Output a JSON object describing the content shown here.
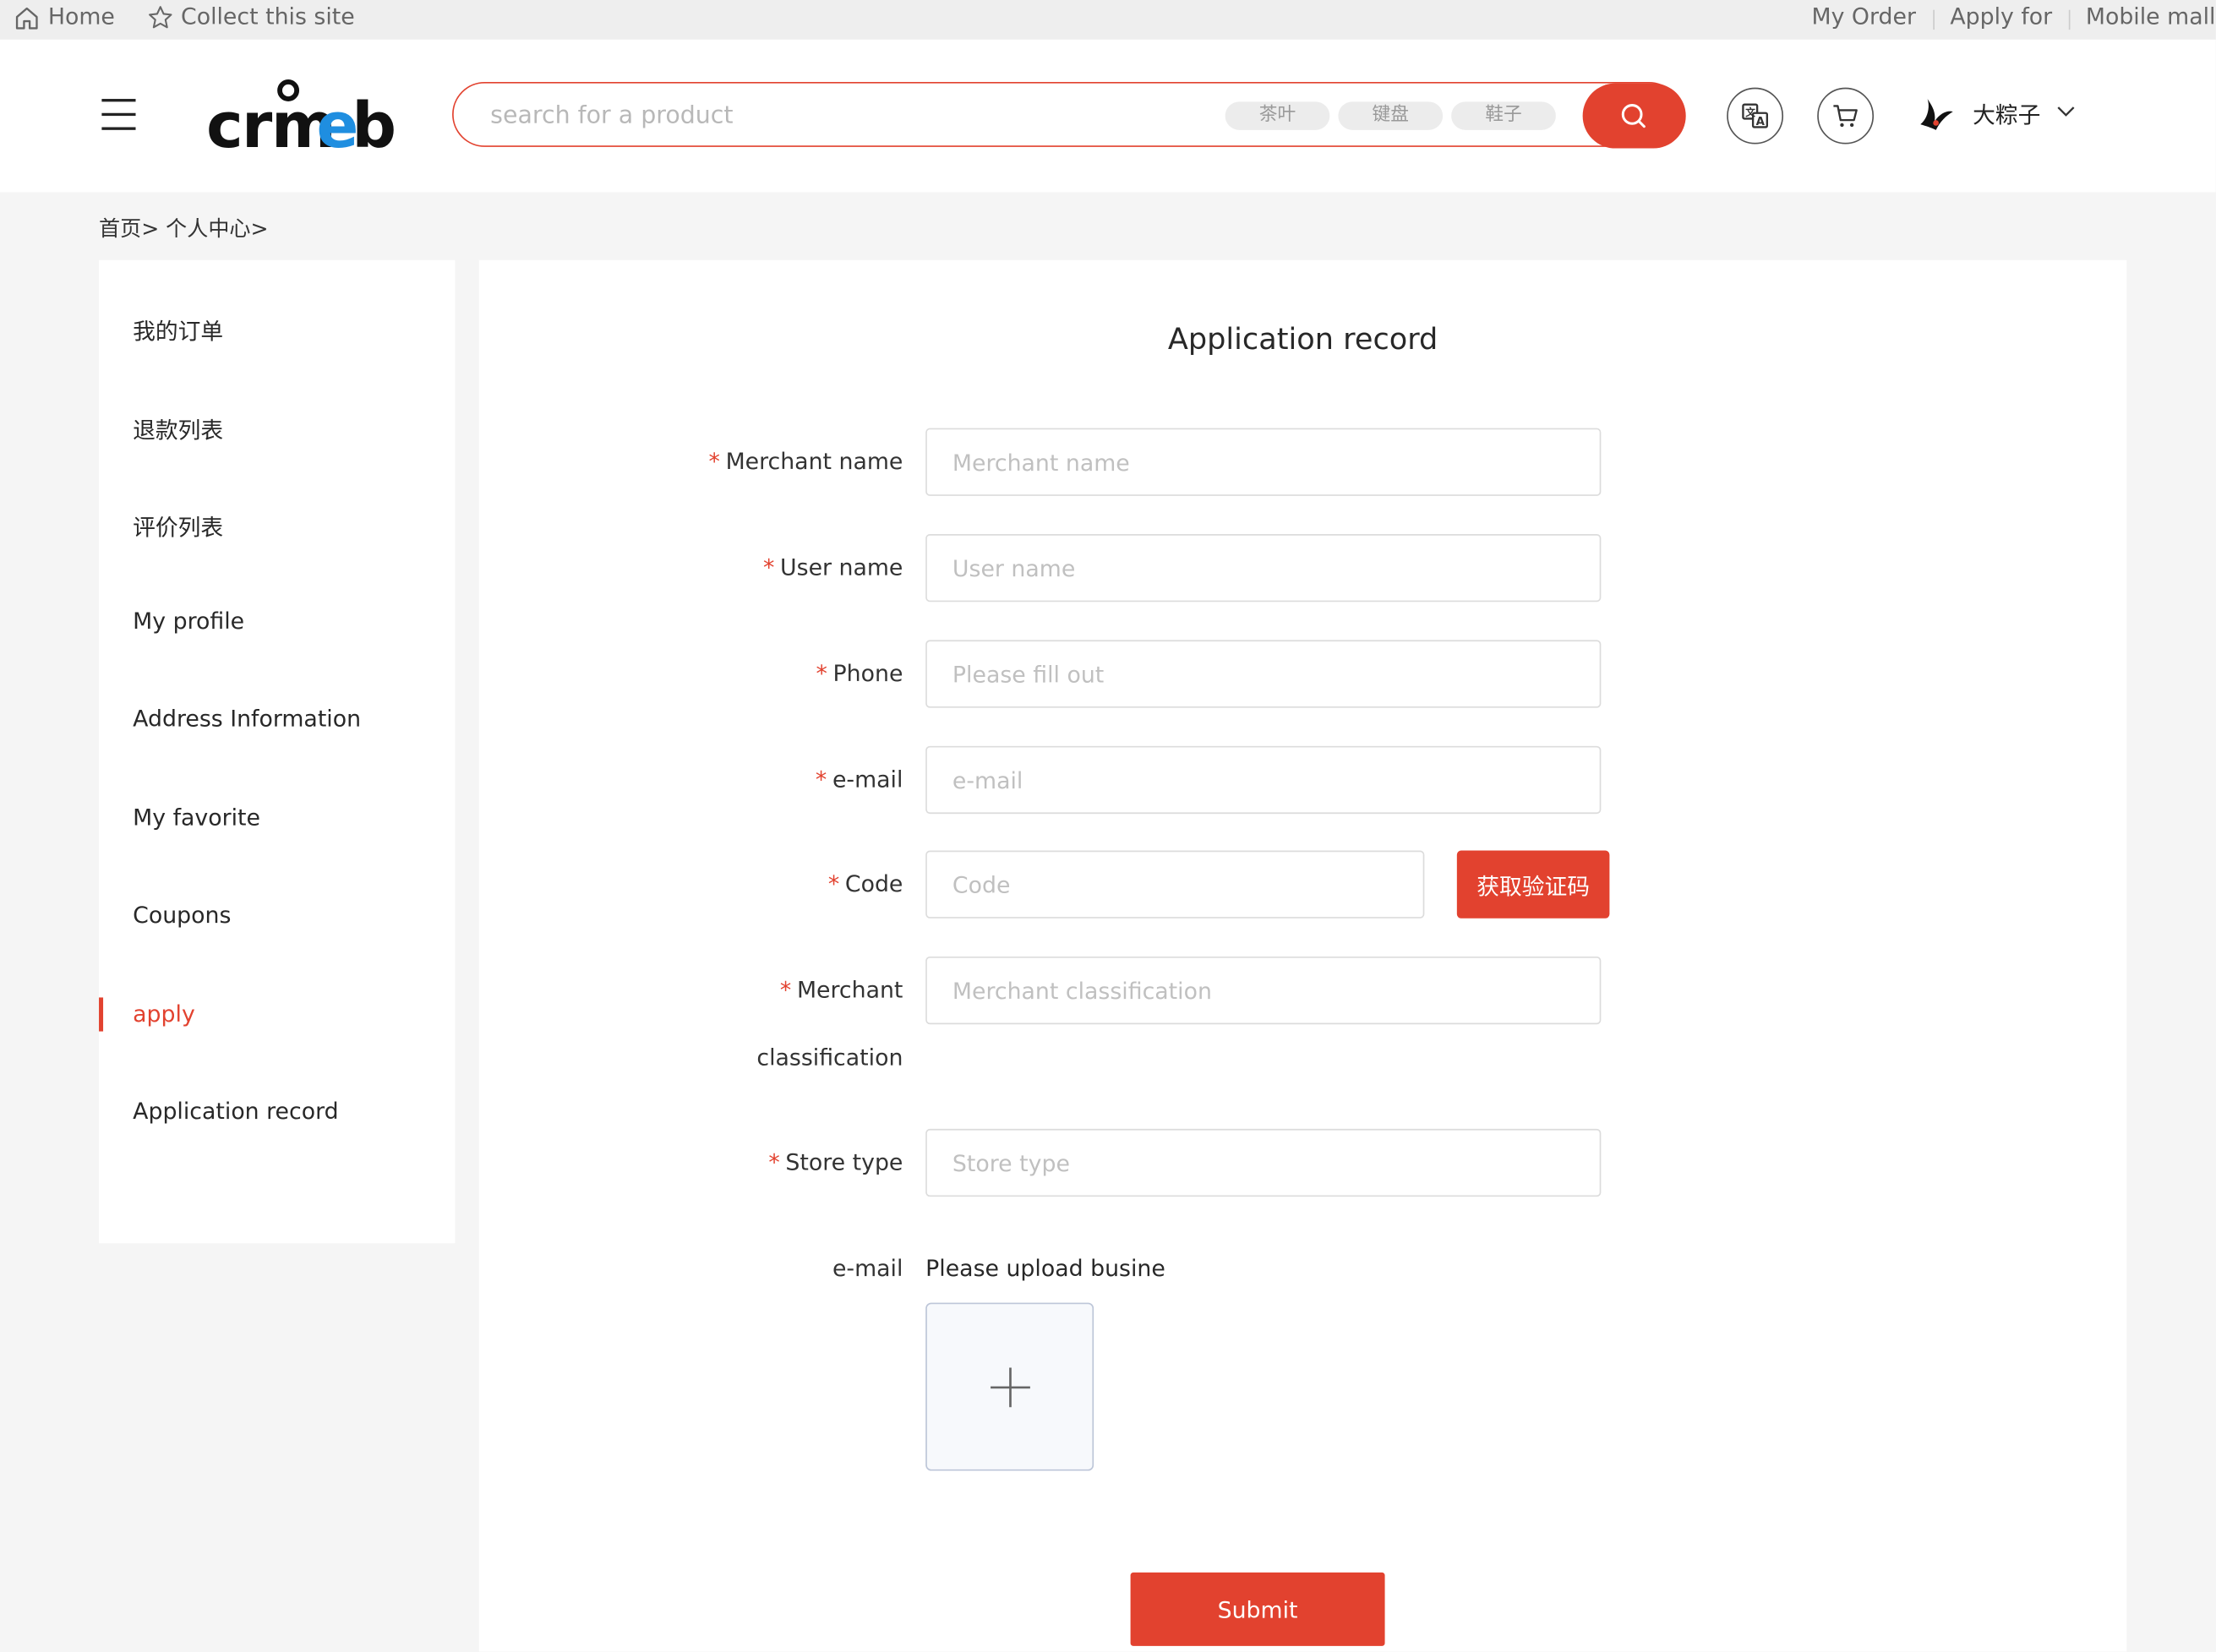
{
  "topbar": {
    "home": "Home",
    "collect": "Collect this site",
    "my_order": "My Order",
    "apply_for": "Apply for",
    "mobile_mall": "Mobile mall"
  },
  "header": {
    "logo_text": "crmeb",
    "search_placeholder": "search for a product",
    "hot_tags": [
      "茶叶",
      "键盘",
      "鞋子"
    ],
    "user_name": "大粽子",
    "accent_color": "#e2422f"
  },
  "breadcrumb": "首页> 个人中心>",
  "sidebar": {
    "items": [
      {
        "label": "我的订单"
      },
      {
        "label": "退款列表"
      },
      {
        "label": "评价列表"
      },
      {
        "label": "My profile"
      },
      {
        "label": "Address Information"
      },
      {
        "label": "My favorite"
      },
      {
        "label": "Coupons"
      },
      {
        "label": "apply",
        "active": true
      },
      {
        "label": "Application record"
      }
    ]
  },
  "form": {
    "title": "Application record",
    "required_mark": "*",
    "fields": {
      "merchant_name": {
        "label": "Merchant name",
        "placeholder": "Merchant name"
      },
      "user_name": {
        "label": "User name",
        "placeholder": "User name"
      },
      "phone": {
        "label": "Phone",
        "placeholder": "Please fill out"
      },
      "email": {
        "label": "e-mail",
        "placeholder": "e-mail"
      },
      "code": {
        "label": "Code",
        "placeholder": "Code",
        "button": "获取验证码"
      },
      "merchant_classification": {
        "label_line1": "Merchant",
        "label_line2": "classification",
        "placeholder": "Merchant classification"
      },
      "store_type": {
        "label": "Store type",
        "placeholder": "Store type"
      },
      "upload": {
        "label": "e-mail",
        "hint": "Please upload busine"
      }
    },
    "submit_label": "Submit"
  }
}
